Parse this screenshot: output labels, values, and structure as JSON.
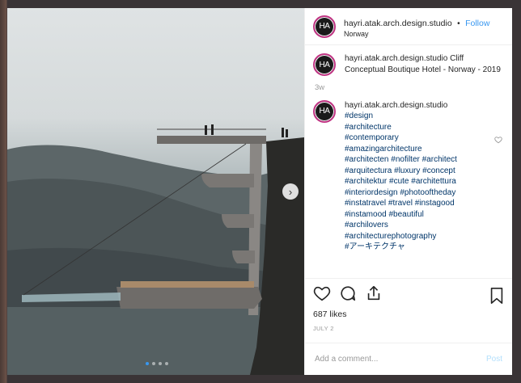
{
  "post": {
    "author": {
      "username": "hayri.atak.arch.design.studio",
      "avatar_text": "HA",
      "location": "Norway",
      "follow_label": "Follow",
      "separator": "•"
    },
    "caption": {
      "username": "hayri.atak.arch.design.studio",
      "text": "Cliff Conceptual Boutique Hotel - Norway - 2019",
      "time_ago": "3w"
    },
    "comment": {
      "username": "hayri.atak.arch.design.studio",
      "hashtags": [
        "#design",
        "#architecture",
        "#contemporary",
        "#amazingarchitecture",
        "#architecten #nofilter #architect",
        "#arquitectura #luxury #concept",
        "#architektur #cute #architettura",
        "#interiordesign #photooftheday",
        "#instatravel #travel #instagood",
        "#instamood #beautiful",
        "#archilovers",
        "#architecturephotography",
        "#アーキテクチャ"
      ]
    },
    "likes_label": "687 likes",
    "date_label": "JULY 2",
    "comment_input": {
      "placeholder": "Add a comment...",
      "post_label": "Post"
    },
    "carousel": {
      "total": 4,
      "active": 0,
      "next_icon": "›"
    },
    "icons": {
      "like": "heart-icon",
      "comment": "comment-bubble-icon",
      "share": "share-icon",
      "save": "bookmark-icon",
      "comment_like": "small-heart-icon"
    },
    "colors": {
      "link": "#3897f0",
      "hashtag": "#003569",
      "avatar_ring": "#c13584"
    }
  }
}
